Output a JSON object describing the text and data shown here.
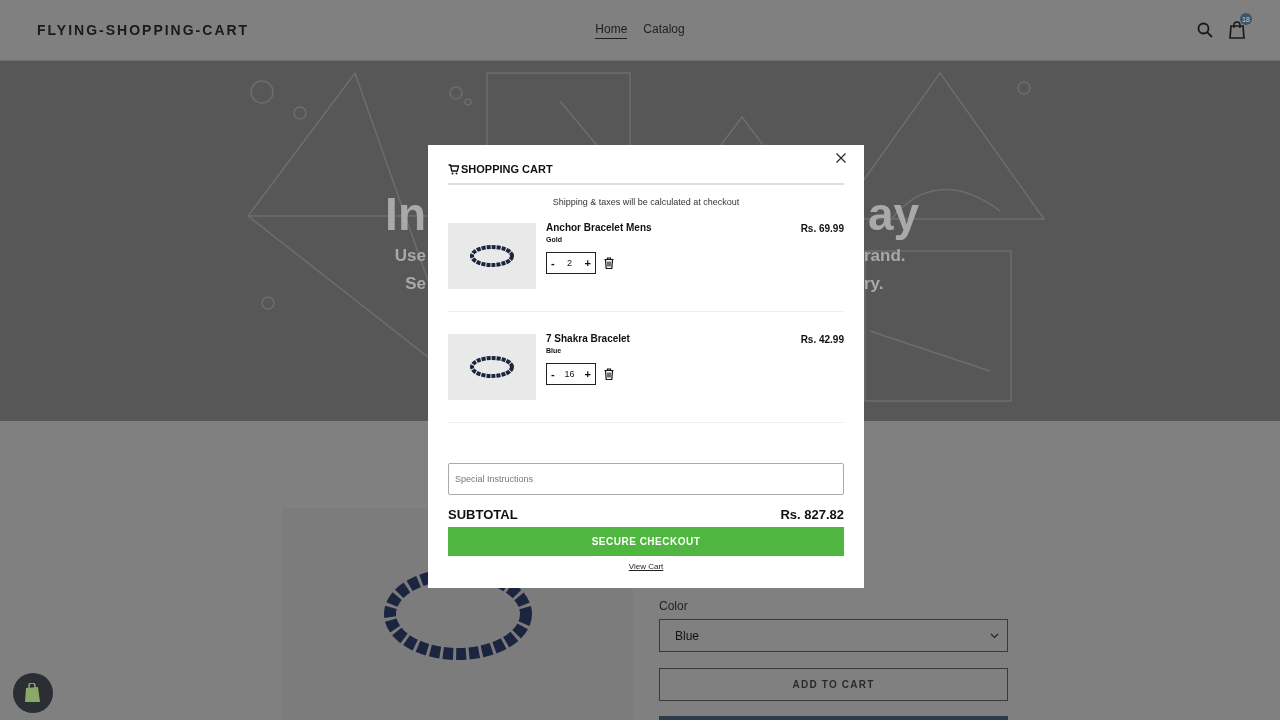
{
  "header": {
    "logo": "FLYING-SHOPPING-CART",
    "nav": [
      {
        "label": "Home",
        "selected": true
      },
      {
        "label": "Catalog",
        "selected": false
      }
    ],
    "cart_count": "18"
  },
  "hero": {
    "lines": [
      {
        "kind": "title",
        "left": "In",
        "right": "ay"
      },
      {
        "kind": "subtitle",
        "left": "Use",
        "right": "rand."
      },
      {
        "kind": "subtitle",
        "left": "Se",
        "right": "ry."
      }
    ]
  },
  "product": {
    "color_label": "Color",
    "color_value": "Blue",
    "add_button": "ADD TO CART"
  },
  "cart_modal": {
    "title": "SHOPPING CART",
    "note": "Shipping & taxes will be calculated at checkout",
    "items": [
      {
        "name": "Anchor Bracelet Mens",
        "variant": "Gold",
        "minus": "-",
        "quantity": "2",
        "plus": "+",
        "price": "Rs. 69.99"
      },
      {
        "name": "7 Shakra Bracelet",
        "variant": "Blue",
        "minus": "-",
        "quantity": "16",
        "plus": "+",
        "price": "Rs. 42.99"
      }
    ],
    "instructions_placeholder": "Special Instructions",
    "subtotal_label": "SUBTOTAL",
    "subtotal": "Rs. 827.82",
    "checkout": "SECURE CHECKOUT",
    "view_cart": "View Cart"
  }
}
